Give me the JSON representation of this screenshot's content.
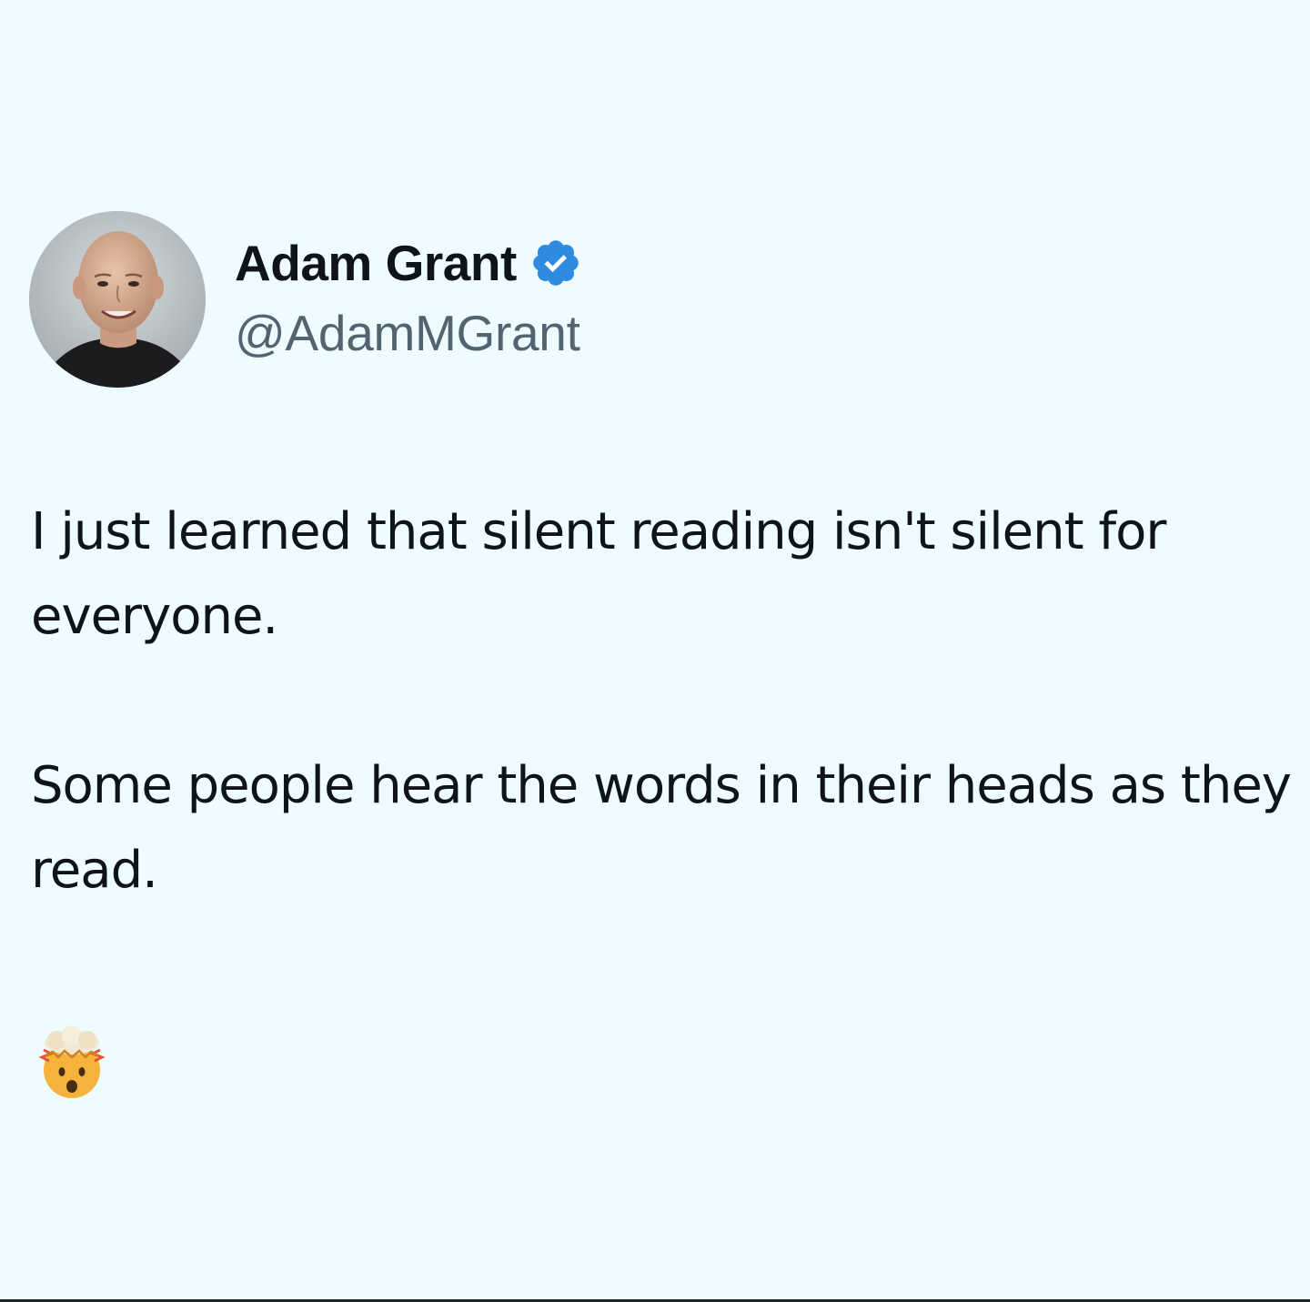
{
  "author": {
    "name": "Adam Grant",
    "handle": "@AdamMGrant",
    "verified": true,
    "avatar_icon": "profile-photo"
  },
  "tweet": {
    "paragraphs": [
      "I just learned that silent reading isn't silent for everyone.",
      "Some people hear the words in their heads as they read."
    ],
    "emoji": "exploding-head-emoji"
  },
  "colors": {
    "background": "#eefbff",
    "text": "#0f1419",
    "handle": "#536471",
    "verified_badge": "#2f8be0"
  }
}
